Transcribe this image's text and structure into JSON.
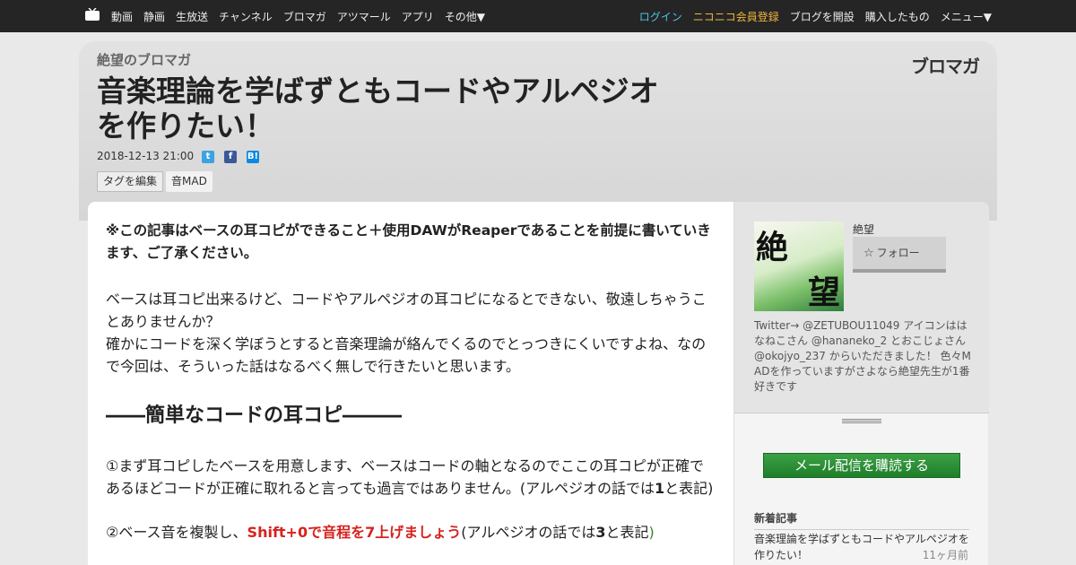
{
  "topnav": {
    "left": [
      "動画",
      "静画",
      "生放送",
      "チャンネル",
      "ブロマガ",
      "アツマール",
      "アプリ",
      "その他▼"
    ],
    "right": [
      "ログイン",
      "ニコニコ会員登録",
      "ブログを開設",
      "購入したもの",
      "メニュー▼"
    ]
  },
  "header": {
    "blog_name": "絶望のブロマガ",
    "logo": "ブロマガ",
    "title_line1": "音楽理論を学ばずともコードやアルペジオ",
    "title_line2": "を作りたい！",
    "date": "2018-12-13 21:00",
    "tag_edit": "タグを編集",
    "tag": "音MAD"
  },
  "article": {
    "notice": "※この記事はベースの耳コピができること＋使用DAWがReaperであることを前提に書いていきます、ご了承ください。",
    "para1": "ベースは耳コピ出来るけど、コードやアルペジオの耳コピになるとできない、敬遠しちゃうことありませんか？",
    "para2": "確かにコードを深く学ぼうとすると音楽理論が絡んでくるのでとっつきにくいですよね、なので今回は、そういった話はなるべく無しで行きたいと思います。",
    "heading1": "――簡単なコードの耳コピ―――",
    "para3_a": "①まず耳コピしたベースを用意します、ベースはコードの軸となるのでここの耳コピが正確であるほどコードが正確に取れると言っても過言ではありません。(アルペジオの話では",
    "para3_num": "1",
    "para3_b": "と表記)",
    "para4_a": "②ベース音を複製し、",
    "para4_red": "Shift+0で音程を7上げましょう",
    "para4_b": "(アルペジオの話では",
    "para4_num": "3",
    "para4_c": "と表記",
    "para4_d": ")"
  },
  "sidebar": {
    "author": "絶望",
    "follow": "フォロー",
    "avatar_text1": "絶",
    "avatar_text2": "望",
    "profile": "Twitter→ @ZETUBOU11049 アイコンははなねこさん @hananeko_2 とおこじょさん @okojyo_237 からいただきました！ 色々MADを作っていますがさよなら絶望先生が1番好きです",
    "subscribe": "メール配信を購読する",
    "recent_title": "新着記事",
    "recent_item": "音楽理論を学ばずともコードやアルペジオを作りたい！",
    "recent_time": "11ヶ月前"
  },
  "colors": {
    "nav_bg": "#252525",
    "login": "#4fc3e8",
    "signup": "#f0b53c",
    "emphasis_red": "#d6231e",
    "subscribe_green": "#2e8f37"
  },
  "icons": [
    "tv-icon",
    "twitter-icon",
    "facebook-icon",
    "hatena-bookmark-icon",
    "star-icon"
  ]
}
